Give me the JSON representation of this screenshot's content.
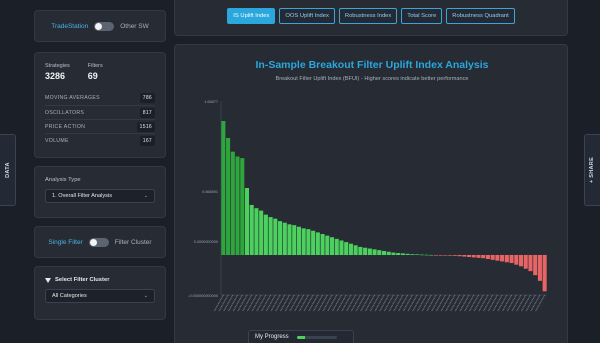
{
  "side_tabs": {
    "left": "DATA",
    "right": "+ SHARE"
  },
  "toggle1": {
    "on_label": "TradeStation",
    "off_label": "Other SW"
  },
  "stats": {
    "strategies_label": "Strategies",
    "strategies_value": "3286",
    "filters_label": "Filters",
    "filters_value": "69",
    "categories": [
      {
        "name": "MOVING AVERAGES",
        "count": "786"
      },
      {
        "name": "OSCILLATORS",
        "count": "817"
      },
      {
        "name": "PRICE ACTION",
        "count": "1516"
      },
      {
        "name": "VOLUME",
        "count": "167"
      }
    ]
  },
  "analysis": {
    "label": "Analysis Type",
    "selected": "1. Overall Filter Analysis"
  },
  "toggle2": {
    "on_label": "Single Filter",
    "off_label": "Filter Cluster"
  },
  "cluster": {
    "title": "Select Filter Cluster",
    "selected": "All Categories"
  },
  "tabs": [
    "IS Uplift Index",
    "OOS Uplift Index",
    "Robustness Index",
    "Total Score",
    "Robustness Quadrant"
  ],
  "progress": {
    "label": "My Progress",
    "fraction": 0.22
  },
  "colors": {
    "positive": "#4cd15e",
    "positive_dark": "#2fa53e",
    "negative": "#e76565",
    "accent": "#2aa7dd",
    "title": "#2aa7dd"
  },
  "chart_data": {
    "type": "bar",
    "title": "In-Sample Breakout Filter Uplift Index Analysis",
    "subtitle": "Breakout Filter Uplift Index (BFUI) - Higher scores indicate better performance",
    "ytick_labels": [
      "1.65877",
      "0.666691",
      "0.0000000000",
      "-0.000000000000"
    ],
    "ylim": [
      -0.9,
      1.9
    ],
    "values": [
      1.66,
      1.45,
      1.28,
      1.22,
      1.2,
      0.83,
      0.62,
      0.58,
      0.55,
      0.5,
      0.47,
      0.45,
      0.42,
      0.4,
      0.38,
      0.37,
      0.35,
      0.33,
      0.32,
      0.3,
      0.28,
      0.26,
      0.24,
      0.22,
      0.2,
      0.18,
      0.16,
      0.14,
      0.12,
      0.1,
      0.09,
      0.08,
      0.07,
      0.06,
      0.05,
      0.04,
      0.03,
      0.025,
      0.02,
      0.015,
      0.01,
      0.008,
      0.005,
      0.003,
      0.001,
      -0.001,
      -0.003,
      -0.005,
      -0.008,
      -0.01,
      -0.015,
      -0.02,
      -0.025,
      -0.03,
      -0.035,
      -0.04,
      -0.05,
      -0.06,
      -0.07,
      -0.08,
      -0.09,
      -0.1,
      -0.12,
      -0.14,
      -0.17,
      -0.2,
      -0.25,
      -0.32,
      -0.45
    ]
  }
}
